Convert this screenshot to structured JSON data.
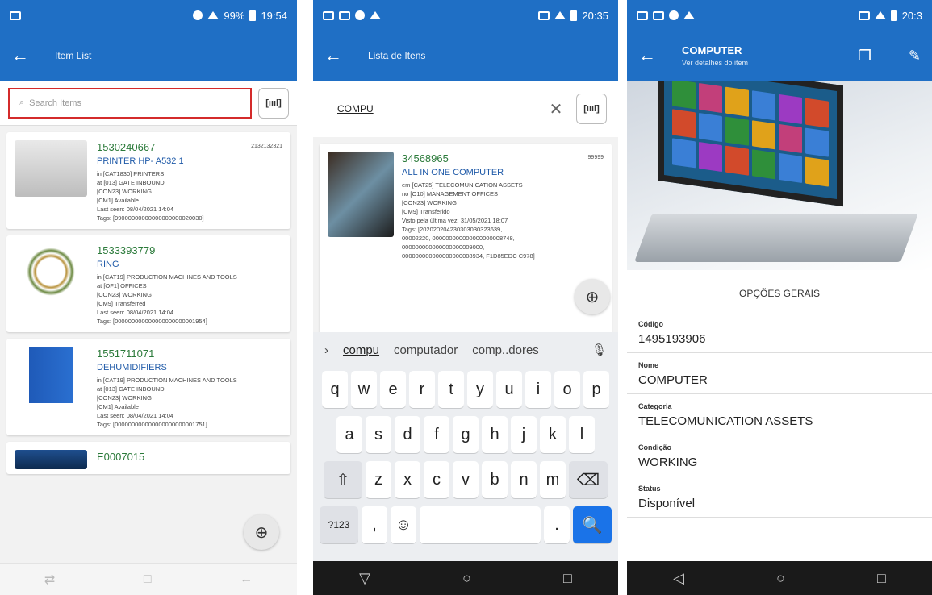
{
  "colors": {
    "primary": "#1f6fc5",
    "code_green": "#2b7a3a",
    "name_blue": "#1f5aa8",
    "highlight_red": "#d42b2b"
  },
  "screen1": {
    "status_time": "19:54",
    "status_battery": "99%",
    "title": "Item List",
    "search_placeholder": "Search Items",
    "scan_label": "[ıııl]",
    "items": [
      {
        "code": "1530240667",
        "top_right": "2132132321",
        "name": "PRINTER HP- A532 1",
        "lines": [
          "in [CAT1830] PRINTERS",
          "at [013] GATE INBOUND",
          "[CON23] WORKING",
          "[CM1] Available",
          "Last seen: 08/04/2021 14:04",
          "Tags: [99000000000000000000020030]"
        ]
      },
      {
        "code": "1533393779",
        "top_right": "",
        "name": "RING",
        "lines": [
          "in [CAT19] PRODUCTION MACHINES AND TOOLS",
          "at [OF1] OFFICES",
          "[CON23] WORKING",
          "[CM9] Transferred",
          "Last seen: 08/04/2021 14:04",
          "Tags: [000000000000000000000001954]"
        ]
      },
      {
        "code": "1551711071",
        "top_right": "",
        "name": "DEHUMIDIFIERS",
        "lines": [
          "in [CAT19] PRODUCTION MACHINES AND TOOLS",
          "at [013] GATE INBOUND",
          "[CON23] WORKING",
          "[CM1] Available",
          "Last seen: 08/04/2021 14:04",
          "Tags: [000000000000000000000001751]"
        ]
      },
      {
        "code": "E0007015",
        "top_right": "",
        "name": "",
        "lines": []
      }
    ],
    "fab_label": "⊕"
  },
  "screen2": {
    "status_time": "20:35",
    "title": "Lista de Itens",
    "search_value": "COMPU",
    "clear_label": "✕",
    "scan_label": "[ıııl]",
    "item": {
      "code": "34568965",
      "top_right": "99999",
      "name": "ALL IN ONE COMPUTER",
      "lines": [
        "em [CAT25] TELECOMUNICATION ASSETS",
        "no [O10] MANAGEMENT OFFICES",
        "[CON23] WORKING",
        "[CM9] Transferido",
        "Visto pela última vez: 31/05/2021 18:07",
        "Tags: [202020204230303030323639,",
        "00002220, 000000000000000000008748,",
        "000000000000000000009000,",
        "000000000000000000008934, F1D85EDC C978]"
      ]
    },
    "fab_label": "⊕",
    "suggestions": [
      "compu",
      "computador",
      "comp..dores"
    ],
    "suggest_arrow": "›",
    "mic": "🎙",
    "keys_row1": [
      "q",
      "w",
      "e",
      "r",
      "t",
      "y",
      "u",
      "i",
      "o",
      "p"
    ],
    "keys_row2": [
      "a",
      "s",
      "d",
      "f",
      "g",
      "h",
      "j",
      "k",
      "l"
    ],
    "keys_row3": [
      "z",
      "x",
      "c",
      "v",
      "b",
      "n",
      "m"
    ],
    "shift": "⇧",
    "backspace": "⌫",
    "sym": "?123",
    "comma": ",",
    "emoji": "☺",
    "period": ".",
    "enter": "🔍",
    "nav_back": "▽",
    "nav_home": "○",
    "nav_recent": "□"
  },
  "screen3": {
    "status_time": "20:3",
    "title": "COMPUTER",
    "subtitle": "Ver detalhes do item",
    "section": "OPÇÕES GERAIS",
    "fields": [
      {
        "label": "Código",
        "value": "1495193906"
      },
      {
        "label": "Nome",
        "value": "COMPUTER"
      },
      {
        "label": "Categoria",
        "value": "TELECOMUNICATION ASSETS"
      },
      {
        "label": "Condição",
        "value": "WORKING"
      },
      {
        "label": "Status",
        "value": "Disponível"
      }
    ],
    "nav_back": "◁",
    "nav_home": "○",
    "nav_recent": "□"
  }
}
